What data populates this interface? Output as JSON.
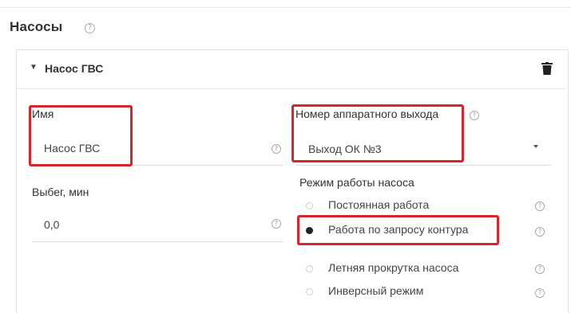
{
  "section": {
    "title": "Насосы",
    "help_glyph": "?"
  },
  "pump": {
    "name": "Насос ГВС",
    "expand_glyph": "▼",
    "delete_icon": "trash-icon"
  },
  "fields": {
    "name": {
      "label": "Имя",
      "value": "Насос ГВС",
      "help_glyph": "?"
    },
    "overrun": {
      "label": "Выбег, мин",
      "value": "0,0",
      "help_glyph": "?"
    },
    "output": {
      "label": "Номер аппаратного выхода",
      "value": "Выход ОК №3",
      "help_glyph": "?"
    }
  },
  "mode": {
    "label": "Режим работы насоса",
    "options": [
      {
        "label": "Постоянная работа",
        "selected": false,
        "help_glyph": "?"
      },
      {
        "label": "Работа по запросу контура",
        "selected": true,
        "help_glyph": "?"
      },
      {
        "label": "Летняя прокрутка насоса",
        "selected": false,
        "help_glyph": "?"
      },
      {
        "label": "Инверсный режим",
        "selected": false,
        "help_glyph": "?"
      }
    ]
  },
  "colors": {
    "highlight": "#d7262b",
    "text": "#333333",
    "border": "#e3e3e3"
  }
}
